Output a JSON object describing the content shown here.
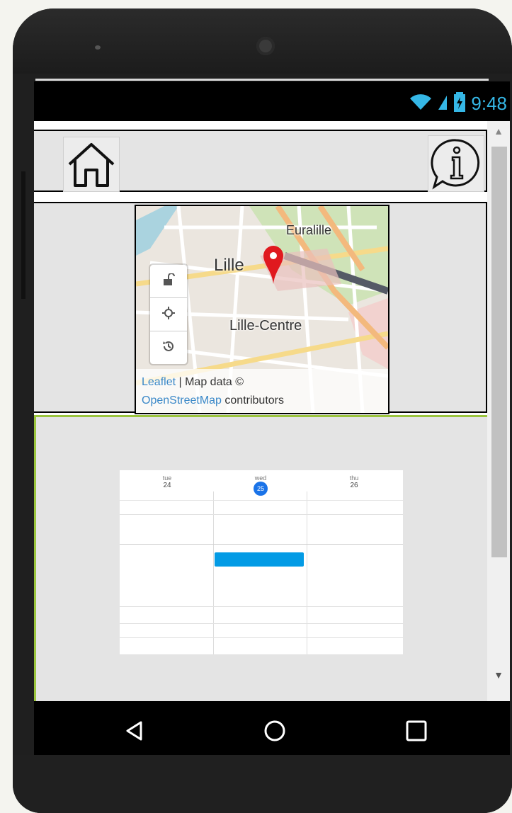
{
  "status_bar": {
    "time": "9:48",
    "icons": [
      "wifi-icon",
      "signal-icon",
      "battery-icon"
    ],
    "accent_color": "#35b7e6"
  },
  "header": {
    "home_icon": "home-icon",
    "info_icon": "info-icon"
  },
  "map": {
    "labels": {
      "lille": "Lille",
      "euralille": "Euralille",
      "lille_centre": "Lille-Centre"
    },
    "controls": [
      "lock-icon",
      "locate-icon",
      "history-icon"
    ],
    "marker_color": "#e0191f",
    "attribution": {
      "leaflet": "Leaflet",
      "map_data": "| Map data ©",
      "osm": "OpenStreetMap",
      "contributors": "contributors"
    }
  },
  "calendar": {
    "days": [
      {
        "weekday": "tue",
        "date": "24"
      },
      {
        "weekday": "wed",
        "date": "25"
      },
      {
        "weekday": "thu",
        "date": "26"
      }
    ],
    "today_color": "#1a73e8",
    "event_color": "#039be5"
  },
  "nav_bar": {
    "back_icon": "back-icon",
    "home_icon": "home-circle-icon",
    "recents_icon": "recents-icon"
  },
  "accent_green": "#9bc53d"
}
